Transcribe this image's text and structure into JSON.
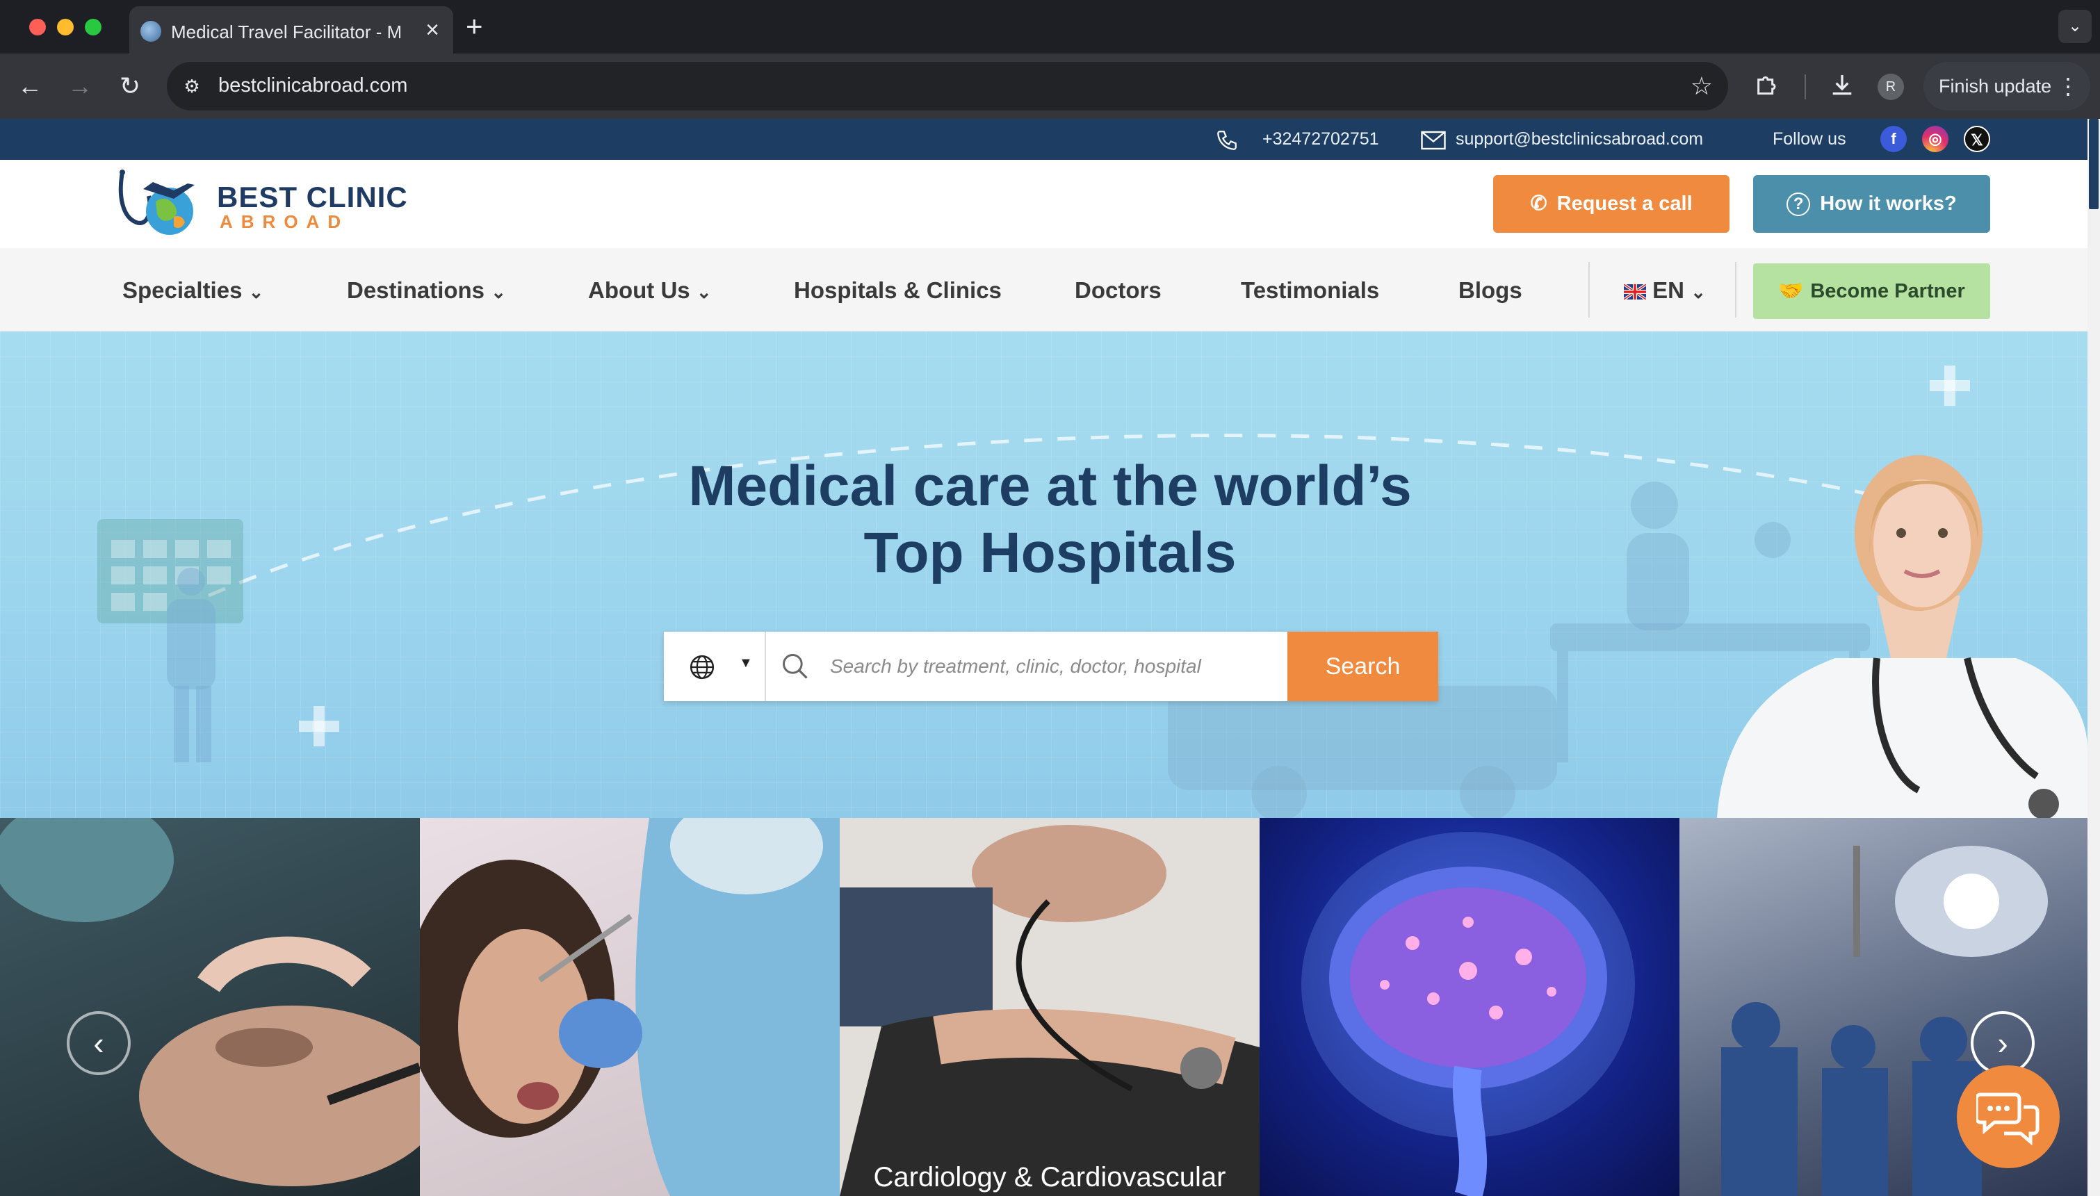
{
  "browser": {
    "tab_title": "Medical Travel Facilitator - Medical Tourism",
    "url": "bestclinicabroad.com",
    "profile_initial": "R",
    "finish_update_label": "Finish update"
  },
  "topbar": {
    "phone": "+32472702751",
    "email": "support@bestclinicsabroad.com",
    "follow_label": "Follow us"
  },
  "header": {
    "logo_line1": "BEST CLINIC",
    "logo_line2": "ABROAD",
    "request_call_label": "Request a call",
    "how_it_works_label": "How it works?"
  },
  "nav": {
    "items": [
      {
        "label": "Specialties"
      },
      {
        "label": "Destinations"
      },
      {
        "label": "About Us"
      },
      {
        "label": "Hospitals & Clinics"
      },
      {
        "label": "Doctors"
      },
      {
        "label": "Testimonials"
      },
      {
        "label": "Blogs"
      }
    ],
    "language": "EN",
    "partner_label": "Become Partner"
  },
  "hero": {
    "title_line1": "Medical care at the world’s",
    "title_line2": "Top Hospitals",
    "search_placeholder": "Search by treatment, clinic, doctor, hospital",
    "search_button": "Search"
  },
  "carousel": {
    "visible_caption": "Cardiology & Cardiovascular"
  },
  "colors": {
    "brand_navy": "#1d3e62",
    "brand_orange": "#ef8a3f",
    "brand_teal": "#4b8fab",
    "partner_green": "#b6e2a1"
  }
}
